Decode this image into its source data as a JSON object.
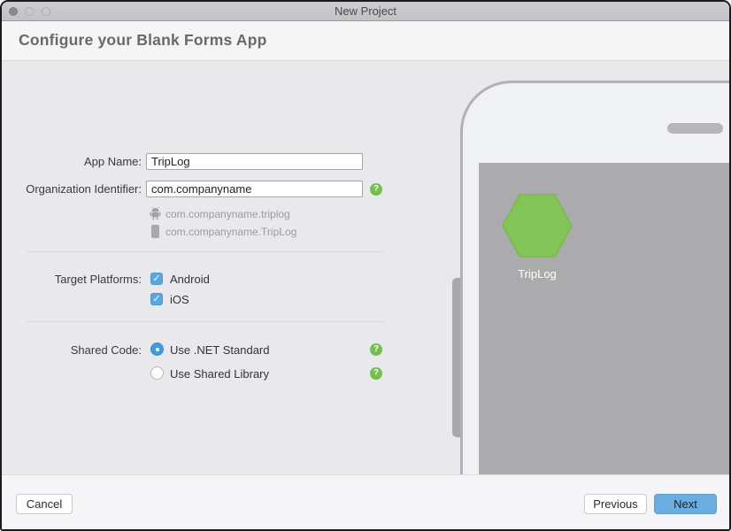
{
  "window": {
    "title": "New Project"
  },
  "header": {
    "title": "Configure your Blank Forms App"
  },
  "form": {
    "app_name": {
      "label": "App Name:",
      "value": "TripLog"
    },
    "org_id": {
      "label": "Organization Identifier:",
      "value": "com.companyname",
      "help_glyph": "?"
    },
    "previews": [
      {
        "icon": "android-icon",
        "text": "com.companyname.triplog"
      },
      {
        "icon": "ios-phone-icon",
        "text": "com.companyname.TripLog"
      }
    ],
    "target_platforms": {
      "label": "Target Platforms:",
      "check_glyph": "✓",
      "options": [
        {
          "label": "Android",
          "checked": true
        },
        {
          "label": "iOS",
          "checked": true
        }
      ]
    },
    "shared_code": {
      "label": "Shared Code:",
      "help_glyph": "?",
      "options": [
        {
          "label": "Use .NET Standard",
          "selected": true
        },
        {
          "label": "Use Shared Library",
          "selected": false
        }
      ]
    }
  },
  "device_preview": {
    "app_label": "TripLog"
  },
  "footer": {
    "cancel": "Cancel",
    "previous": "Previous",
    "next": "Next"
  },
  "colors": {
    "accent_blue": "#58a6e2",
    "help_green": "#71c04c",
    "hexagon_green": "#82c455",
    "screen_gray": "#ababad",
    "next_button": "#6badde"
  }
}
